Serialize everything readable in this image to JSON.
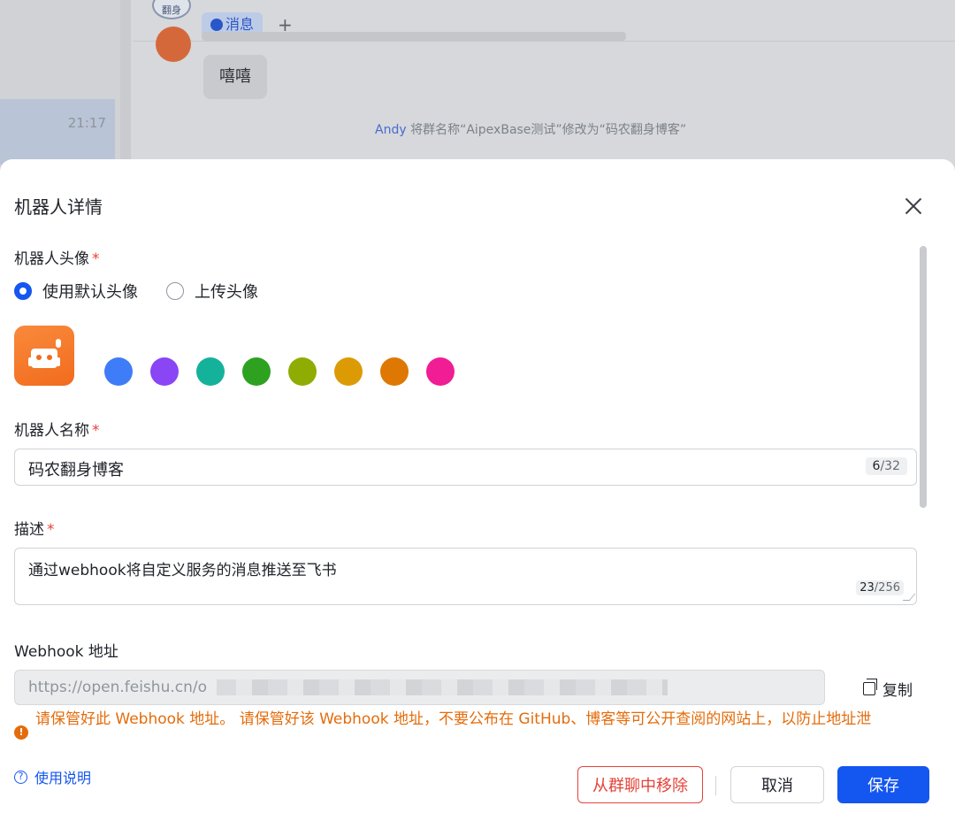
{
  "background": {
    "group_logo_text": "翻身",
    "tab_label": "消息",
    "add_tab": "+",
    "conversation_time": "21:17",
    "bubble_text": "嘻嘻",
    "system_message_actor": "Andy",
    "system_message_text": " 将群名称“AipexBase测试”修改为“码农翻身博客”"
  },
  "modal": {
    "title": "机器人详情",
    "avatar_label": "机器人头像",
    "required_mark": "*",
    "avatar_options": [
      "使用默认头像",
      "上传头像"
    ],
    "avatar_selected": 0,
    "avatar_colors": [
      "#3f7cf7",
      "#8a45f5",
      "#14b29b",
      "#2ea121",
      "#8fac02",
      "#dc9b04",
      "#de7802",
      "#f01d94"
    ],
    "name_label": "机器人名称",
    "name_value": "码农翻身博客",
    "name_count": "6",
    "name_max": "/32",
    "desc_label": "描述",
    "desc_value": "通过webhook将自定义服务的消息推送至飞书",
    "desc_count": "23",
    "desc_max": "/256",
    "webhook_label": "Webhook 地址",
    "webhook_value": "https://open.feishu.cn/o",
    "copy_label": "复制",
    "warning_icon": "!",
    "warning_text": "请保管好此 Webhook 地址。 请保管好该 Webhook 地址，不要公布在 GitHub、博客等可公开查阅的网站上，以防止地址泄",
    "help_icon": "?",
    "help_label": "使用说明",
    "remove_label": "从群聊中移除",
    "cancel_label": "取消",
    "save_label": "保存"
  }
}
